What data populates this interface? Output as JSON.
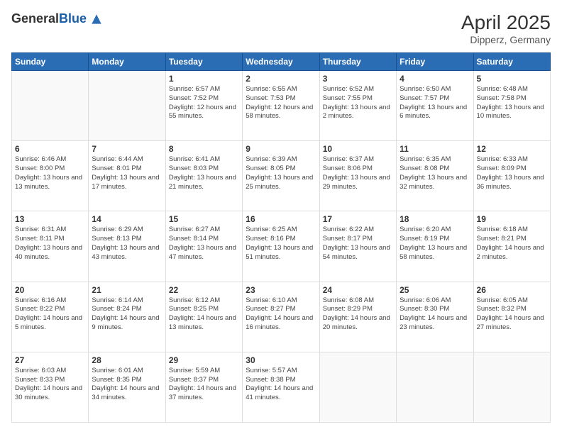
{
  "header": {
    "logo": {
      "general": "General",
      "blue": "Blue"
    },
    "title": "April 2025",
    "location": "Dipperz, Germany"
  },
  "calendar": {
    "days": [
      "Sunday",
      "Monday",
      "Tuesday",
      "Wednesday",
      "Thursday",
      "Friday",
      "Saturday"
    ],
    "weeks": [
      [
        {
          "num": "",
          "info": ""
        },
        {
          "num": "",
          "info": ""
        },
        {
          "num": "1",
          "info": "Sunrise: 6:57 AM\nSunset: 7:52 PM\nDaylight: 12 hours\nand 55 minutes."
        },
        {
          "num": "2",
          "info": "Sunrise: 6:55 AM\nSunset: 7:53 PM\nDaylight: 12 hours\nand 58 minutes."
        },
        {
          "num": "3",
          "info": "Sunrise: 6:52 AM\nSunset: 7:55 PM\nDaylight: 13 hours\nand 2 minutes."
        },
        {
          "num": "4",
          "info": "Sunrise: 6:50 AM\nSunset: 7:57 PM\nDaylight: 13 hours\nand 6 minutes."
        },
        {
          "num": "5",
          "info": "Sunrise: 6:48 AM\nSunset: 7:58 PM\nDaylight: 13 hours\nand 10 minutes."
        }
      ],
      [
        {
          "num": "6",
          "info": "Sunrise: 6:46 AM\nSunset: 8:00 PM\nDaylight: 13 hours\nand 13 minutes."
        },
        {
          "num": "7",
          "info": "Sunrise: 6:44 AM\nSunset: 8:01 PM\nDaylight: 13 hours\nand 17 minutes."
        },
        {
          "num": "8",
          "info": "Sunrise: 6:41 AM\nSunset: 8:03 PM\nDaylight: 13 hours\nand 21 minutes."
        },
        {
          "num": "9",
          "info": "Sunrise: 6:39 AM\nSunset: 8:05 PM\nDaylight: 13 hours\nand 25 minutes."
        },
        {
          "num": "10",
          "info": "Sunrise: 6:37 AM\nSunset: 8:06 PM\nDaylight: 13 hours\nand 29 minutes."
        },
        {
          "num": "11",
          "info": "Sunrise: 6:35 AM\nSunset: 8:08 PM\nDaylight: 13 hours\nand 32 minutes."
        },
        {
          "num": "12",
          "info": "Sunrise: 6:33 AM\nSunset: 8:09 PM\nDaylight: 13 hours\nand 36 minutes."
        }
      ],
      [
        {
          "num": "13",
          "info": "Sunrise: 6:31 AM\nSunset: 8:11 PM\nDaylight: 13 hours\nand 40 minutes."
        },
        {
          "num": "14",
          "info": "Sunrise: 6:29 AM\nSunset: 8:13 PM\nDaylight: 13 hours\nand 43 minutes."
        },
        {
          "num": "15",
          "info": "Sunrise: 6:27 AM\nSunset: 8:14 PM\nDaylight: 13 hours\nand 47 minutes."
        },
        {
          "num": "16",
          "info": "Sunrise: 6:25 AM\nSunset: 8:16 PM\nDaylight: 13 hours\nand 51 minutes."
        },
        {
          "num": "17",
          "info": "Sunrise: 6:22 AM\nSunset: 8:17 PM\nDaylight: 13 hours\nand 54 minutes."
        },
        {
          "num": "18",
          "info": "Sunrise: 6:20 AM\nSunset: 8:19 PM\nDaylight: 13 hours\nand 58 minutes."
        },
        {
          "num": "19",
          "info": "Sunrise: 6:18 AM\nSunset: 8:21 PM\nDaylight: 14 hours\nand 2 minutes."
        }
      ],
      [
        {
          "num": "20",
          "info": "Sunrise: 6:16 AM\nSunset: 8:22 PM\nDaylight: 14 hours\nand 5 minutes."
        },
        {
          "num": "21",
          "info": "Sunrise: 6:14 AM\nSunset: 8:24 PM\nDaylight: 14 hours\nand 9 minutes."
        },
        {
          "num": "22",
          "info": "Sunrise: 6:12 AM\nSunset: 8:25 PM\nDaylight: 14 hours\nand 13 minutes."
        },
        {
          "num": "23",
          "info": "Sunrise: 6:10 AM\nSunset: 8:27 PM\nDaylight: 14 hours\nand 16 minutes."
        },
        {
          "num": "24",
          "info": "Sunrise: 6:08 AM\nSunset: 8:29 PM\nDaylight: 14 hours\nand 20 minutes."
        },
        {
          "num": "25",
          "info": "Sunrise: 6:06 AM\nSunset: 8:30 PM\nDaylight: 14 hours\nand 23 minutes."
        },
        {
          "num": "26",
          "info": "Sunrise: 6:05 AM\nSunset: 8:32 PM\nDaylight: 14 hours\nand 27 minutes."
        }
      ],
      [
        {
          "num": "27",
          "info": "Sunrise: 6:03 AM\nSunset: 8:33 PM\nDaylight: 14 hours\nand 30 minutes."
        },
        {
          "num": "28",
          "info": "Sunrise: 6:01 AM\nSunset: 8:35 PM\nDaylight: 14 hours\nand 34 minutes."
        },
        {
          "num": "29",
          "info": "Sunrise: 5:59 AM\nSunset: 8:37 PM\nDaylight: 14 hours\nand 37 minutes."
        },
        {
          "num": "30",
          "info": "Sunrise: 5:57 AM\nSunset: 8:38 PM\nDaylight: 14 hours\nand 41 minutes."
        },
        {
          "num": "",
          "info": ""
        },
        {
          "num": "",
          "info": ""
        },
        {
          "num": "",
          "info": ""
        }
      ]
    ]
  }
}
